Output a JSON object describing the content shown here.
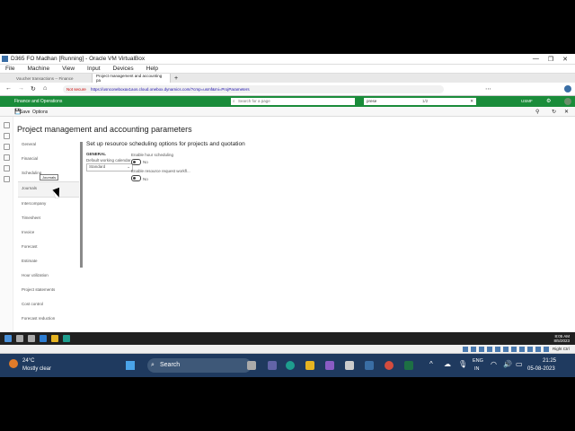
{
  "vbox": {
    "title": "D365 FO Madhan [Running] - Oracle VM VirtualBox",
    "menu": [
      "File",
      "Machine",
      "View",
      "Input",
      "Devices",
      "Help"
    ]
  },
  "browser": {
    "tabs": [
      {
        "label": "Voucher transactions -- Finance",
        "active": false
      },
      {
        "label": "Project management and accounting pa",
        "active": true
      }
    ],
    "not_secure": "Not secure",
    "url": "https://usnconeboxax1aos.cloud.onebox.dynamics.com/?cmp=usmf&mi=ProjParameters"
  },
  "d365": {
    "app_name": "Finance and Operations",
    "search_placeholder": "Search for a page",
    "company": "USMF",
    "find_value": "prese",
    "find_count": "1/2"
  },
  "actionbar": {
    "save": "Save",
    "options": "Options"
  },
  "page": {
    "title": "Project management and accounting parameters",
    "tabs": [
      "General",
      "Financial",
      "Scheduling",
      "Journals",
      "Intercompany",
      "Timesheet",
      "Invoice",
      "Forecast",
      "Estimate",
      "Hour utilization",
      "Project statements",
      "Cost control",
      "Forecast reduction"
    ],
    "selected_tab": "Journals",
    "tooltip": "Journals",
    "section_title": "Set up resource scheduling options for projects and quotation",
    "general_header": "GENERAL",
    "calendar_label": "Default working calendar",
    "calendar_value": "Standard",
    "enable_hour_label": "Enable hour scheduling",
    "enable_hour_value": "No",
    "enable_resource_label": "Enable resource request workfl...",
    "enable_resource_value": "No"
  },
  "vm_taskbar": {
    "time": "8:05 AM",
    "date": "8/5/2023"
  },
  "vbox_status": {
    "host_key": "Right Ctrl"
  },
  "windows": {
    "weather_temp": "24°C",
    "weather_desc": "Mostly clear",
    "search": "Search",
    "lang": "ENG",
    "region": "IN",
    "time": "21:25",
    "date": "05-08-2023"
  },
  "colors": {
    "d365_green": "#1a8c3a",
    "taskbar": "#1f3a5f"
  }
}
